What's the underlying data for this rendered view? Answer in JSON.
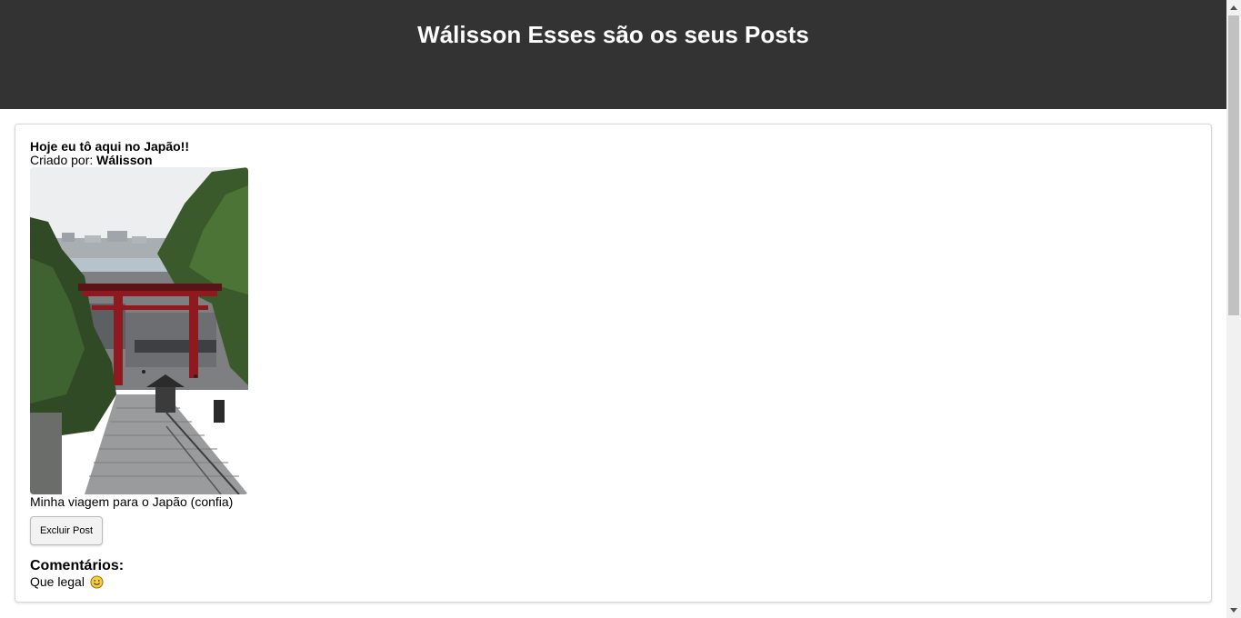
{
  "header": {
    "title": "Wálisson Esses são os seus Posts"
  },
  "posts": [
    {
      "title": "Hoje eu tô aqui no Japão!!",
      "author_prefix": "Criado por:",
      "author_name": "Wálisson",
      "image_subject": "Japanese torii gate over stone stairway with town and sea in background",
      "caption": "Minha viagem para o Japão (confia)",
      "delete_label": "Excluir Post",
      "comments_heading": "Comentários:",
      "comments": [
        {
          "text": "Que legal",
          "emoji": "smiling-face-emoji"
        }
      ]
    }
  ],
  "colors": {
    "header_bg": "#333333",
    "header_text": "#ffffff",
    "card_border": "#d6d6d6",
    "button_bg": "#f2f2f2",
    "torii_red": "#8e1a1f"
  },
  "icons": {
    "scroll_up": "scroll-up-arrow-icon",
    "scroll_down": "scroll-down-arrow-icon"
  }
}
